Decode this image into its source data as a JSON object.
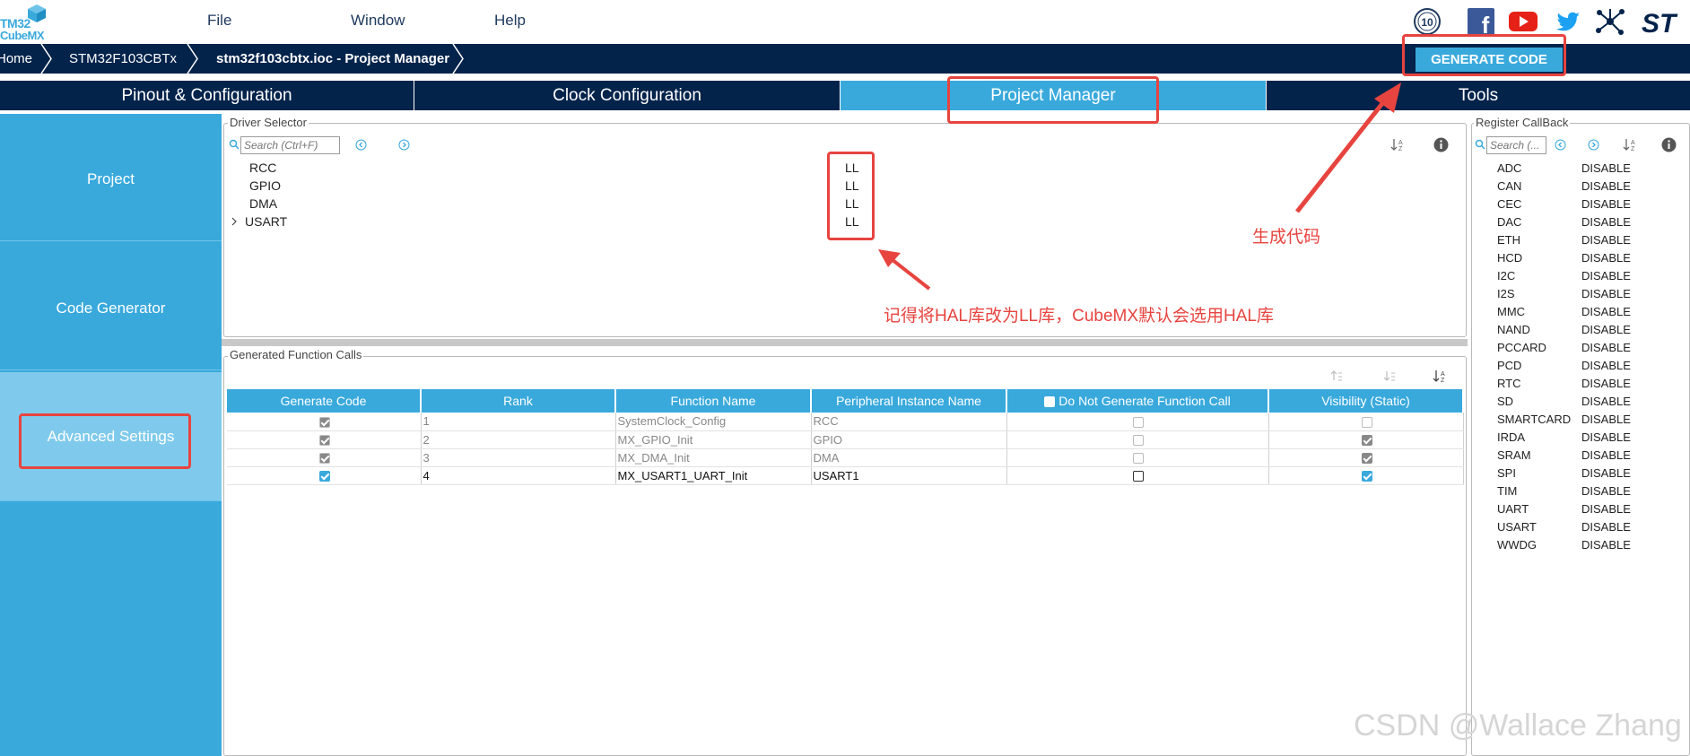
{
  "logo": {
    "line1": "TM32",
    "line2": "CubeMX"
  },
  "menu": {
    "file": "File",
    "window": "Window",
    "help": "Help"
  },
  "social": {
    "anniversary": "10",
    "facebook": "f",
    "youtube": "▶",
    "twitter": "🐦",
    "network": "✲",
    "st": "ST"
  },
  "breadcrumb": {
    "home": "Home",
    "mcu": "STM32F103CBTx",
    "project": "stm32f103cbtx.ioc - Project Manager"
  },
  "generate_button": "GENERATE CODE",
  "tabs": [
    "Pinout & Configuration",
    "Clock Configuration",
    "Project Manager",
    "Tools"
  ],
  "left_nav": [
    "Project",
    "Code Generator",
    "Advanced Settings"
  ],
  "driver_selector": {
    "legend": "Driver Selector",
    "search_placeholder": "Search (Ctrl+F)",
    "rows": [
      {
        "name": "RCC",
        "value": "LL"
      },
      {
        "name": "GPIO",
        "value": "LL"
      },
      {
        "name": "DMA",
        "value": "LL"
      },
      {
        "name": "USART",
        "value": "LL"
      }
    ]
  },
  "generated_calls": {
    "legend": "Generated Function Calls",
    "headers": [
      "Generate Code",
      "Rank",
      "Function Name",
      "Peripheral Instance Name",
      "Do Not Generate Function Call",
      "Visibility (Static)"
    ],
    "rows": [
      {
        "rank": "1",
        "function": "SystemClock_Config",
        "instance": "RCC",
        "generate": true,
        "do_not_generate": false,
        "visibility": false,
        "enabled": false
      },
      {
        "rank": "2",
        "function": "MX_GPIO_Init",
        "instance": "GPIO",
        "generate": true,
        "do_not_generate": false,
        "visibility": true,
        "enabled": false
      },
      {
        "rank": "3",
        "function": "MX_DMA_Init",
        "instance": "DMA",
        "generate": true,
        "do_not_generate": false,
        "visibility": true,
        "enabled": false
      },
      {
        "rank": "4",
        "function": "MX_USART1_UART_Init",
        "instance": "USART1",
        "generate": true,
        "do_not_generate": false,
        "visibility": true,
        "enabled": true
      }
    ]
  },
  "register_callback": {
    "legend": "Register CallBack",
    "search_placeholder": "Search (...",
    "rows": [
      {
        "name": "ADC",
        "value": "DISABLE"
      },
      {
        "name": "CAN",
        "value": "DISABLE"
      },
      {
        "name": "CEC",
        "value": "DISABLE"
      },
      {
        "name": "DAC",
        "value": "DISABLE"
      },
      {
        "name": "ETH",
        "value": "DISABLE"
      },
      {
        "name": "HCD",
        "value": "DISABLE"
      },
      {
        "name": "I2C",
        "value": "DISABLE"
      },
      {
        "name": "I2S",
        "value": "DISABLE"
      },
      {
        "name": "MMC",
        "value": "DISABLE"
      },
      {
        "name": "NAND",
        "value": "DISABLE"
      },
      {
        "name": "PCCARD",
        "value": "DISABLE"
      },
      {
        "name": "PCD",
        "value": "DISABLE"
      },
      {
        "name": "RTC",
        "value": "DISABLE"
      },
      {
        "name": "SD",
        "value": "DISABLE"
      },
      {
        "name": "SMARTCARD",
        "value": "DISABLE"
      },
      {
        "name": "IRDA",
        "value": "DISABLE"
      },
      {
        "name": "SRAM",
        "value": "DISABLE"
      },
      {
        "name": "SPI",
        "value": "DISABLE"
      },
      {
        "name": "TIM",
        "value": "DISABLE"
      },
      {
        "name": "UART",
        "value": "DISABLE"
      },
      {
        "name": "USART",
        "value": "DISABLE"
      },
      {
        "name": "WWDG",
        "value": "DISABLE"
      }
    ]
  },
  "annotations": {
    "generate_note": "生成代码",
    "ll_note": "记得将HAL库改为LL库，CubeMX默认会选用HAL库"
  },
  "watermark": "CSDN @Wallace Zhang",
  "colors": {
    "accent": "#39a9dc",
    "navy": "#03234b",
    "annotation": "#e7443f"
  }
}
